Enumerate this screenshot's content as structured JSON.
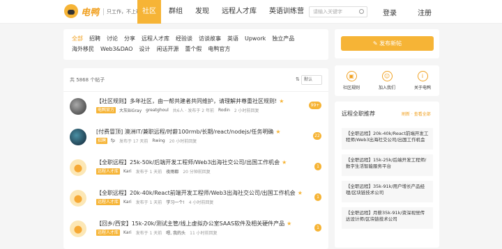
{
  "header": {
    "logo_text": "电鸭",
    "slogan": "只工作，不上班",
    "nav": [
      "社区",
      "群组",
      "发现",
      "远程人才库",
      "英语训练营"
    ],
    "active_nav": 0,
    "search_placeholder": "请输入关键字",
    "login": "登录",
    "register": "注册"
  },
  "tags": [
    "全部",
    "招聘",
    "讨论",
    "分享",
    "远程人才库",
    "经验谈",
    "访谈故事",
    "英语",
    "Upwork",
    "独立产品",
    "海外移民",
    "Web3&DAO",
    "设计",
    "闲话开源",
    "蕾个假",
    "电鸭官方"
  ],
  "list": {
    "count_text": "共 5868 个帖子",
    "sort_label": "默认"
  },
  "posts": [
    {
      "title": "【社区规则】多年社区，由一帮共建者共同维护，请理解并尊重社区规则!",
      "star": "★",
      "badge": "电鸭官方",
      "meta": [
        "大灰BiGray",
        "greatghoul",
        "共6人 · 发布于 2 年前",
        "Rodin",
        "2 小时前回复"
      ],
      "count": "99+"
    },
    {
      "title": "[付费冒顶] 澳洲IT/兼职远程/时薪100rmb/长期/react/nodejs/任务明确",
      "star": "★",
      "badge": "招聘",
      "meta": [
        "fp",
        "发布于 17 天前",
        "Rwing",
        "20 小时前回复"
      ],
      "count": "22"
    },
    {
      "title": "【全职远程】25k-50k/后端开发工程师/Web3出海社交公司/出国工作机会",
      "star": "★",
      "badge": "远程人才库",
      "meta": [
        "Kari",
        "发布于 1 天前",
        "夜雨都",
        "20 分钟前回复"
      ],
      "count": "1"
    },
    {
      "title": "【全职远程】20k-40k/React前端开发工程师/Web3出海社交公司/出国工作机会",
      "star": "★",
      "badge": "远程人才库",
      "meta": [
        "Kari",
        "发布于 1 天前",
        "学习一个!",
        "4 小时前回复"
      ],
      "count": "1"
    },
    {
      "title": "【回乡/西安】15k-20k/测试主管/线上虚拟办公室SAAS软件及相关硬件产品",
      "star": "★",
      "badge": "远程人才库",
      "meta": [
        "Kari",
        "发布于 1 天前",
        "嗯, 我的头",
        "11 小时前回复"
      ],
      "count": "1"
    }
  ],
  "sidebar": {
    "publish": "发布新帖",
    "quick": [
      "社区规则",
      "加入我们",
      "关于电鸭"
    ],
    "rec_title": "远程全职推荐",
    "rec_links": "刷新 · 查看全部",
    "recs": [
      "【全职远程】20k-40k/React前端开发工程师/Web3出海社交公司/出国工作机会",
      "【全职远程】15k-25k/后端开发工程师/数字生活智能服务平台",
      "【全职远程】35k-91k/用户增长产品经理/区块链技术公司",
      "【全职远程】月薪35k-91k/资深视觉传达设计师/区块链技术公司"
    ]
  },
  "colors": {
    "accent": "#f6b436"
  }
}
